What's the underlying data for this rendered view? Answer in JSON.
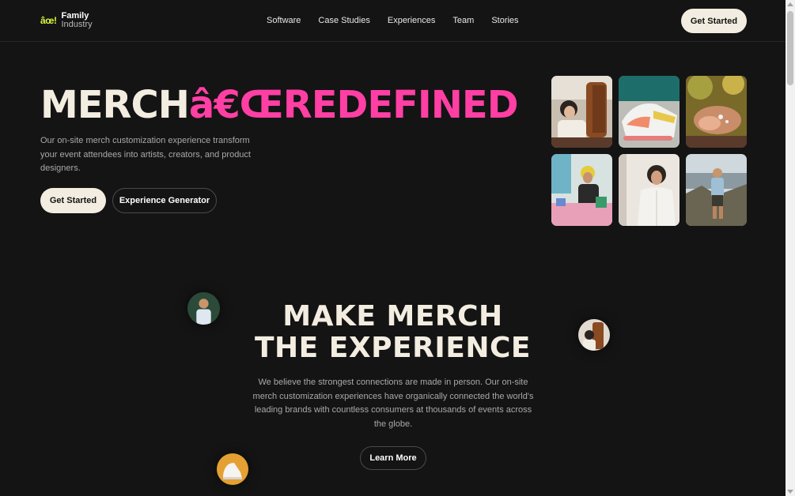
{
  "header": {
    "logo_mark": "âœ!",
    "logo_line1": "Family",
    "logo_line2": "Industry",
    "nav": [
      "Software",
      "Case Studies",
      "Experiences",
      "Team",
      "Stories"
    ],
    "cta_label": "Get Started"
  },
  "hero": {
    "title_white": "MERCH",
    "title_pink": "â€ŒREDEFINED",
    "description": "Our on-site merch customization experience transform your event attendees into artists, creators, and product designers.",
    "primary_button": "Get Started",
    "secondary_button": "Experience Generator"
  },
  "gallery": {
    "images": [
      "person-with-jacket-photo",
      "sneakers-photo",
      "painted-hands-photo",
      "workshop-photo",
      "woman-in-white-jacket-photo",
      "hiker-photo"
    ]
  },
  "section": {
    "title_line1": "MAKE MERCH",
    "title_line2": "THE EXPERIENCE",
    "description": "We believe the strongest connections are made in person. Our on-site merch customization experiences have organically connected the world's leading brands with countless consumers at thousands of events across the globe.",
    "button": "Learn More"
  },
  "colors": {
    "background": "#141414",
    "accent_pink": "#ff3fa4",
    "cream": "#f3ede1",
    "logo_lime": "#d9f53a"
  }
}
